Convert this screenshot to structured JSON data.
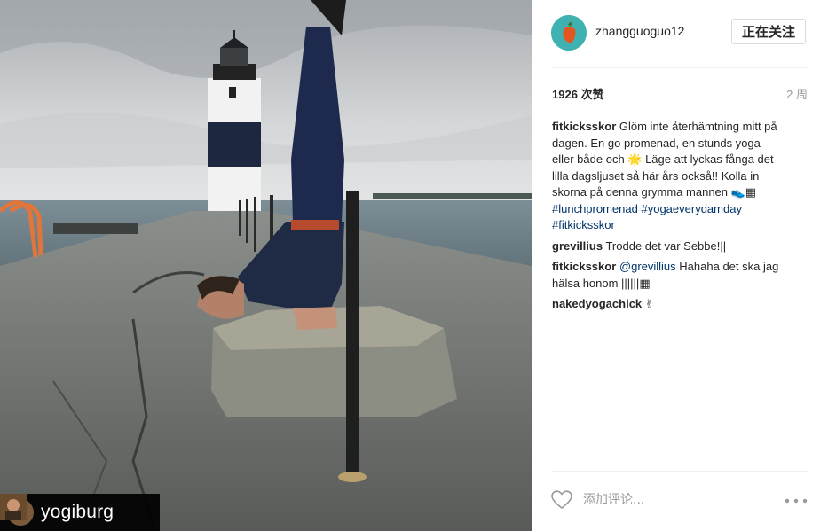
{
  "post": {
    "username": "zhangguoguo12",
    "follow_label": "正在关注",
    "likes": "1926 次赞",
    "age": "2 周",
    "comment_placeholder": "添加评论...",
    "repost_badge": {
      "username": "yogiburg"
    }
  },
  "comments": [
    {
      "author": "fitkicksskor",
      "lines": [
        "Glöm inte återhämtning mitt på",
        "dagen. En go promenad, en stunds yoga -",
        "eller både och 🌟 Läge att lyckas fånga det",
        "lilla dagsljuset så här års också!! Kolla in",
        "skorna på denna grymma mannen 👟▦"
      ],
      "tags": [
        "#lunchpromenad",
        "#yogaeverydamday",
        "#fitkicksskor"
      ]
    },
    {
      "author": "grevillius",
      "text": "Trodde det var Sebbe!||"
    },
    {
      "author": "fitkicksskor",
      "mention": "@grevillius",
      "text_1": "Hahaha det ska jag",
      "text_2": "hälsa honom ||||||▦"
    },
    {
      "author": "nakedyogachick",
      "text": "✌"
    }
  ],
  "icons": [
    "repost-icon",
    "heart-icon",
    "more-options-icon"
  ],
  "colors": {
    "link": "#003569",
    "muted": "#999999",
    "avatar_bg": "#3fb1b0"
  }
}
